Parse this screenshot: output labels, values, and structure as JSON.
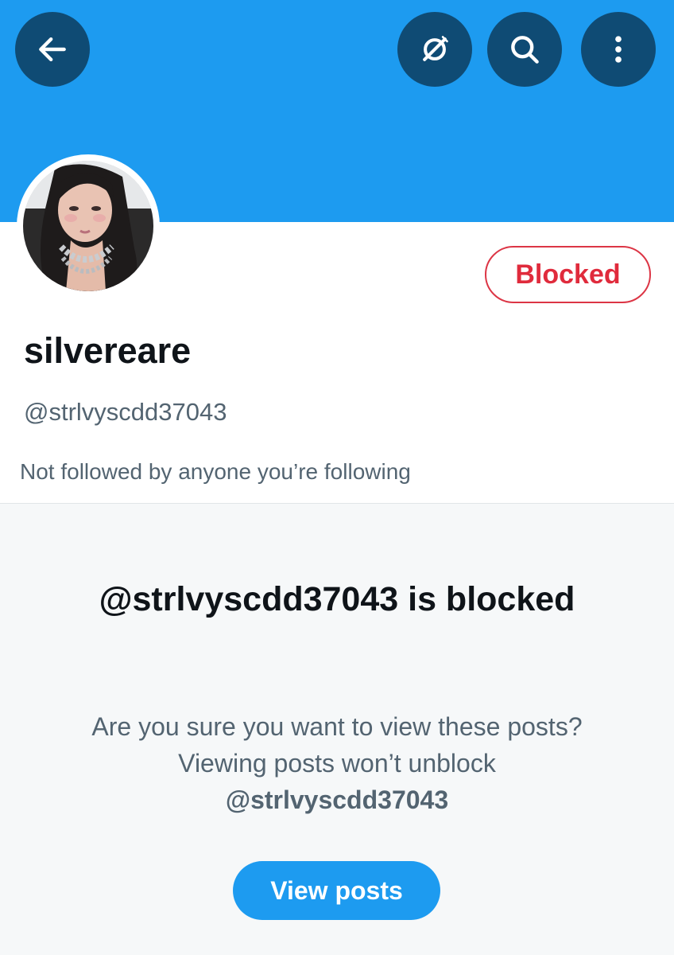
{
  "header": {
    "back_icon": "arrow-left-icon",
    "grok_icon": "grok-icon",
    "search_icon": "search-icon",
    "more_icon": "more-vertical-icon"
  },
  "profile": {
    "display_name": "silvereare",
    "handle": "@strlvyscdd37043",
    "followed_by": "Not followed by anyone you’re following",
    "blocked_label": "Blocked"
  },
  "notice": {
    "title": "@strlvyscdd37043 is blocked",
    "body_text": "Are you sure you want to view these posts? Viewing posts won’t unblock",
    "body_mention": "@strlvyscdd37043",
    "view_posts_label": "View posts"
  },
  "colors": {
    "banner": "#1d9bf0",
    "header_button": "#0f4b74",
    "blocked_red": "#e02b3c",
    "accent_blue": "#1d9bf0",
    "primary_text": "#0f1419",
    "secondary_text": "#536471"
  }
}
